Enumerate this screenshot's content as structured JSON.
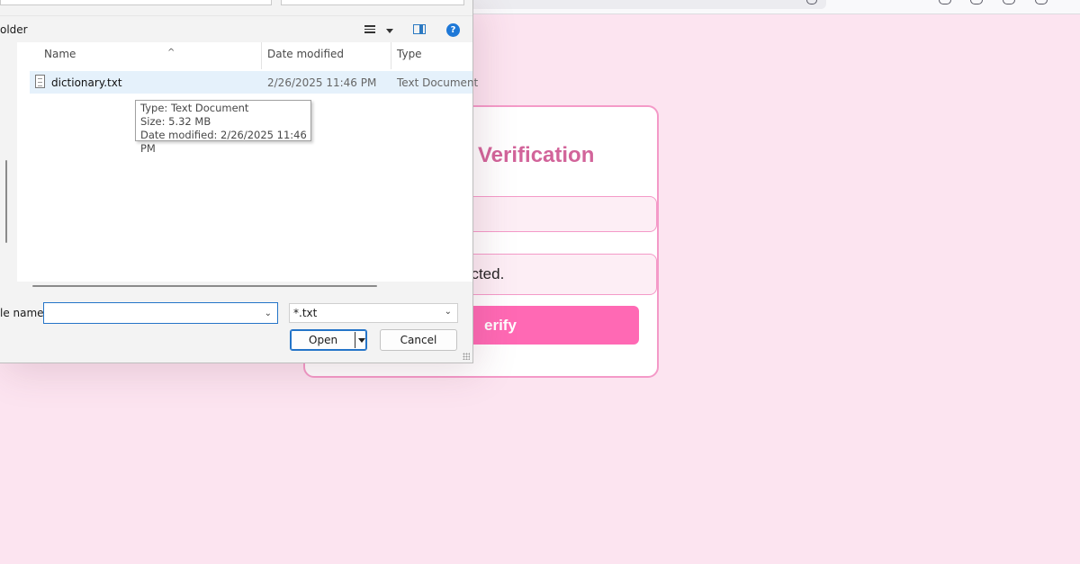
{
  "page": {
    "card_title": "Verification",
    "status_text": "ected.",
    "verify_label": "erify"
  },
  "dialog": {
    "cmd_label": "older",
    "columns": {
      "name": "Name",
      "date": "Date modified",
      "type": "Type"
    },
    "files": [
      {
        "name": "dictionary.txt",
        "date": "2/26/2025 11:46 PM",
        "type": "Text Document"
      }
    ],
    "tooltip": {
      "type": "Type: Text Document",
      "size": "Size: 5.32 MB",
      "date": "Date modified: 2/26/2025 11:46 PM"
    },
    "file_name_label": "le name:",
    "file_name_value": "",
    "filter_value": "*.txt",
    "open_label": "Open",
    "cancel_label": "Cancel",
    "help_glyph": "?"
  },
  "colors": {
    "page_bg": "#fce4f0",
    "accent_pink": "#ff69b4",
    "title_pink": "#d2649a",
    "dialog_blue": "#2474c8"
  }
}
